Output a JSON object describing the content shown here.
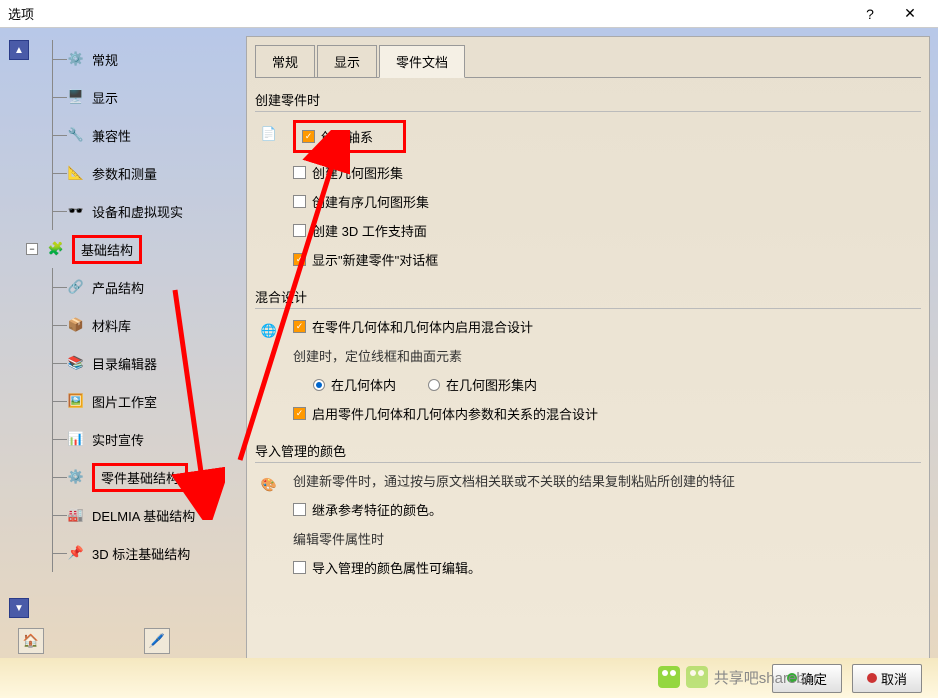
{
  "window": {
    "title": "选项",
    "help": "?",
    "close": "✕"
  },
  "tree": {
    "items": [
      {
        "label": "常规",
        "child": true
      },
      {
        "label": "显示",
        "child": true
      },
      {
        "label": "兼容性",
        "child": true
      },
      {
        "label": "参数和测量",
        "child": true
      },
      {
        "label": "设备和虚拟现实",
        "child": true
      },
      {
        "label": "基础结构",
        "child": false,
        "hl": true,
        "exp": true
      },
      {
        "label": "产品结构",
        "child": true
      },
      {
        "label": "材料库",
        "child": true
      },
      {
        "label": "目录编辑器",
        "child": true
      },
      {
        "label": "图片工作室",
        "child": true
      },
      {
        "label": "实时宣传",
        "child": true
      },
      {
        "label": "零件基础结构",
        "child": true,
        "hl": true
      },
      {
        "label": "DELMIA 基础结构",
        "child": true
      },
      {
        "label": "3D 标注基础结构",
        "child": true
      }
    ]
  },
  "tabs": [
    {
      "label": "常规"
    },
    {
      "label": "显示"
    },
    {
      "label": "零件文档",
      "active": true
    }
  ],
  "group1": {
    "title": "创建零件时",
    "opts": [
      {
        "label": "创建轴系",
        "on": true,
        "hl": true
      },
      {
        "label": "创建几何图形集",
        "on": false
      },
      {
        "label": "创建有序几何图形集",
        "on": false
      },
      {
        "label": "创建 3D 工作支持面",
        "on": false
      },
      {
        "label": "显示\"新建零件\"对话框",
        "on": true
      }
    ]
  },
  "group2": {
    "title": "混合设计",
    "opt1": {
      "label": "在零件几何体和几何体内启用混合设计",
      "on": true
    },
    "note": "创建时，定位线框和曲面元素",
    "radios": [
      {
        "label": "在几何体内",
        "on": true
      },
      {
        "label": "在几何图形集内",
        "on": false
      }
    ],
    "opt2": {
      "label": "启用零件几何体和几何体内参数和关系的混合设计",
      "on": true
    }
  },
  "group3": {
    "title": "导入管理的颜色",
    "note": "创建新零件时，通过按与原文档相关联或不关联的结果复制粘贴所创建的特征",
    "opt1": {
      "label": "继承参考特征的颜色。",
      "on": false
    },
    "note2": "编辑零件属性时",
    "opt2": {
      "label": "导入管理的颜色属性可编辑。",
      "on": false
    }
  },
  "footer": {
    "ok": "确定",
    "cancel": "取消"
  },
  "watermark": "共享吧sharebar"
}
